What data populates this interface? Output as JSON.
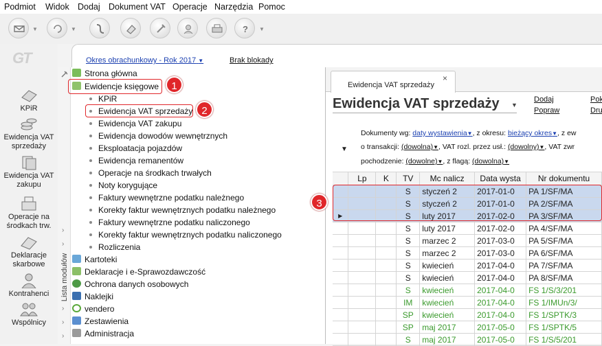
{
  "menu": [
    "Podmiot",
    "Widok",
    "Dodaj",
    "Dokument VAT",
    "Operacje",
    "Narzędzia",
    "Pomoc"
  ],
  "toolbar_icons": [
    "mail-icon",
    "refresh-icon",
    "flow-icon",
    "eraser-icon",
    "tools-icon",
    "users-icon",
    "printer-icon",
    "help-icon"
  ],
  "logo": "GT",
  "left_nav": [
    {
      "label": "KPiR",
      "icon": "book-icon"
    },
    {
      "label": "Ewidencja VAT sprzedaży",
      "icon": "coins-icon"
    },
    {
      "label": "Ewidencja VAT zakupu",
      "icon": "docs-icon"
    },
    {
      "label": "Operacje na środkach trw.",
      "icon": "cash-register-icon"
    },
    {
      "label": "Deklaracje skarbowe",
      "icon": "folder-icon"
    },
    {
      "label": "Kontrahenci",
      "icon": "person-icon"
    },
    {
      "label": "Wspólnicy",
      "icon": "partners-icon"
    }
  ],
  "header": {
    "okres": "Okres obrachunkowy - Rok 2017",
    "brak_blokady": "Brak blokady"
  },
  "module_list_label": "Lista modułów",
  "tree": {
    "top": [
      {
        "label": "Strona główna",
        "icon": "home-icon"
      },
      {
        "label": "Ewidencje księgowe",
        "icon": "ledger-icon"
      }
    ],
    "sub": [
      "KPiR",
      "Ewidencja VAT sprzedaży",
      "Ewidencja VAT zakupu",
      "Ewidencja dowodów wewnętrznych",
      "Eksploatacja pojazdów",
      "Ewidencja remanentów",
      "Operacje na środkach trwałych",
      "Noty korygujące",
      "Faktury wewnętrzne podatku należnego",
      "Korekty faktur wewnętrznych podatku należnego",
      "Faktury wewnętrzne podatku naliczonego",
      "Korekty faktur wewnętrznych podatku naliczonego",
      "Rozliczenia"
    ],
    "bottom": [
      {
        "label": "Kartoteki",
        "icon": "cards-icon"
      },
      {
        "label": "Deklaracje i e-Sprawozdawczość",
        "icon": "declaration-icon"
      },
      {
        "label": "Ochrona danych osobowych",
        "icon": "shield-icon"
      },
      {
        "label": "Naklejki",
        "icon": "sticker-icon"
      },
      {
        "label": "vendero",
        "icon": "vendero-icon"
      },
      {
        "label": "Zestawienia",
        "icon": "chart-icon"
      },
      {
        "label": "Administracja",
        "icon": "admin-icon"
      }
    ]
  },
  "badges": [
    "1",
    "2",
    "3"
  ],
  "tab": {
    "label": "Ewidencja VAT sprzedaży",
    "close": "×"
  },
  "title": "Ewidencja VAT sprzedaży",
  "actions": {
    "dodaj": "Dodaj",
    "popraw": "Popraw",
    "pok": "Pok",
    "dru": "Dru"
  },
  "filters": {
    "dokumenty_wg": "Dokumenty wg:",
    "data_wystawienia": "daty wystawienia",
    "z_okresu": ", z okresu:",
    "biezacy_okres": "bieżący okres",
    "z_ew": ", z ew",
    "o_transakcji": "o transakcji:",
    "dowolna1": "(dowolna)",
    "vat_rozl": ", VAT rozl. przez usł.:",
    "dowolny": "(dowolny)",
    "vat_zwr": ", VAT zwr",
    "pochodzenie": "pochodzenie:",
    "dowolne": "(dowolne)",
    "z_flaga": ", z flagą:",
    "dowolna2": "(dowolna)"
  },
  "table": {
    "columns": [
      "",
      "Lp",
      "K",
      "TV",
      "Mc nalicz",
      "Data wysta",
      "Nr dokumentu"
    ],
    "rows": [
      {
        "tv": "S",
        "mc": "styczeń 2",
        "data": "2017-01-0",
        "nr": "PA 1/SF/MA",
        "sel": true,
        "green": false,
        "mark": ""
      },
      {
        "tv": "S",
        "mc": "styczeń 2",
        "data": "2017-01-0",
        "nr": "PA 2/SF/MA",
        "sel": true,
        "green": false,
        "mark": ""
      },
      {
        "tv": "S",
        "mc": "luty 2017",
        "data": "2017-02-0",
        "nr": "PA 3/SF/MA",
        "sel": true,
        "green": false,
        "mark": "▶"
      },
      {
        "tv": "S",
        "mc": "luty 2017",
        "data": "2017-02-0",
        "nr": "PA 4/SF/MA",
        "sel": false,
        "green": false,
        "mark": ""
      },
      {
        "tv": "S",
        "mc": "marzec 2",
        "data": "2017-03-0",
        "nr": "PA 5/SF/MA",
        "sel": false,
        "green": false,
        "mark": ""
      },
      {
        "tv": "S",
        "mc": "marzec 2",
        "data": "2017-03-0",
        "nr": "PA 6/SF/MA",
        "sel": false,
        "green": false,
        "mark": ""
      },
      {
        "tv": "S",
        "mc": "kwiecień",
        "data": "2017-04-0",
        "nr": "PA 7/SF/MA",
        "sel": false,
        "green": false,
        "mark": ""
      },
      {
        "tv": "S",
        "mc": "kwiecień",
        "data": "2017-04-0",
        "nr": "PA 8/SF/MA",
        "sel": false,
        "green": false,
        "mark": ""
      },
      {
        "tv": "S",
        "mc": "kwiecień",
        "data": "2017-04-0",
        "nr": "FS 1/S/3/201",
        "sel": false,
        "green": true,
        "mark": ""
      },
      {
        "tv": "IM",
        "mc": "kwiecień",
        "data": "2017-04-0",
        "nr": "FS 1/IMUn/3/",
        "sel": false,
        "green": true,
        "mark": ""
      },
      {
        "tv": "SP",
        "mc": "kwiecień",
        "data": "2017-04-0",
        "nr": "FS 1/SPTK/3",
        "sel": false,
        "green": true,
        "mark": ""
      },
      {
        "tv": "SP",
        "mc": "maj 2017",
        "data": "2017-05-0",
        "nr": "FS 1/SPTK/5",
        "sel": false,
        "green": true,
        "mark": ""
      },
      {
        "tv": "S",
        "mc": "maj 2017",
        "data": "2017-05-0",
        "nr": "FS 1/S/5/201",
        "sel": false,
        "green": true,
        "mark": ""
      }
    ]
  },
  "colors": {
    "highlight_red": "#e0262a",
    "selection_blue": "#c9d8ee",
    "link_blue": "#1a3fb0",
    "green_text": "#3a9a2c"
  }
}
